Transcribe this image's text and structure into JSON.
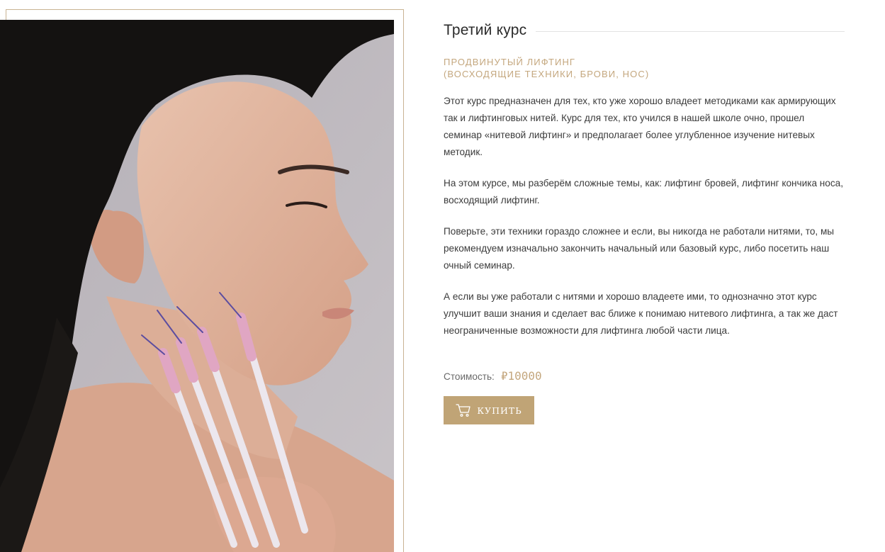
{
  "course": {
    "title": "Третий курс",
    "subtitle_line1": "ПРОДВИНУТЫЙ ЛИФТИНГ",
    "subtitle_line2": "(ВОСХОДЯЩИЕ ТЕХНИКИ, БРОВИ, НОС)",
    "paragraphs": [
      "Этот курс предназначен для тех, кто уже хорошо владеет методиками как армирующих так и лифтинговых нитей. Курс для тех, кто учился в нашей школе очно, прошел семинар «нитевой лифтинг» и предполагает более углубленное изучение нитевых методик.",
      "На этом курсе, мы разберём сложные темы, как: лифтинг бровей, лифтинг кончика носа, восходящий лифтинг.",
      "Поверьте, эти техники гораздо сложнее и если, вы никогда не работали нитями, то, мы рекомендуем изначально закончить начальный или базовый курс, либо посетить наш очный семинар.",
      "А если вы уже работали с нитями и хорошо владеете ими, то однозначно этот курс улучшит ваши знания и сделает вас ближе к понимаю нитевого лифтинга, а так же даст неограниченные возможности для лифтинга любой части лица."
    ],
    "price_label": "Стоимость:",
    "price_value": "₽10000",
    "buy_label": "КУПИТЬ"
  },
  "icons": {
    "buy_button": "cart-icon"
  },
  "colors": {
    "accent": "#c4a77e",
    "button_bg": "#c0a476",
    "frame_border": "#c9b393",
    "text": "#3b3b3b"
  }
}
